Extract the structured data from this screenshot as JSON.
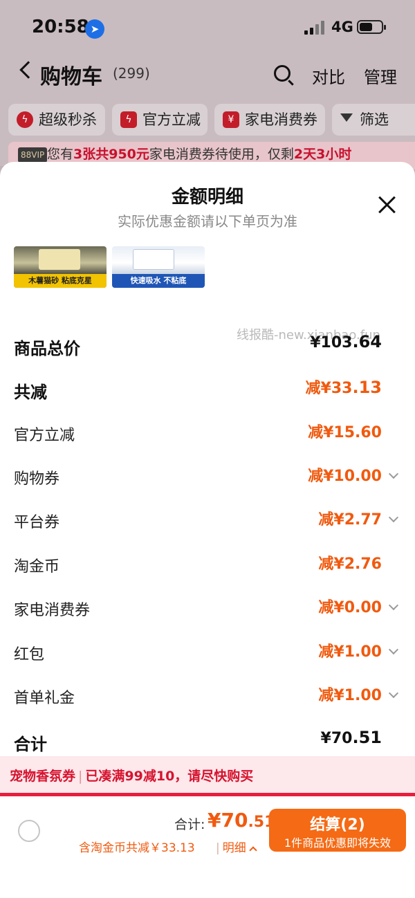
{
  "status_bar": {
    "time": "20:58",
    "network": "4G"
  },
  "cart_header": {
    "title": "购物车",
    "count": "(299)",
    "compare": "对比",
    "manage": "管理"
  },
  "filters": [
    {
      "label": "超级秒杀"
    },
    {
      "label": "官方立减"
    },
    {
      "label": "家电消费券"
    },
    {
      "label": "筛选"
    }
  ],
  "vip_notice": {
    "badge": "88VIP",
    "text_1": "您有",
    "highlight_1": "3张共950元",
    "text_2": "家电消费券待使用，仅剩",
    "highlight_2": "2天3小时"
  },
  "sheet": {
    "title": "金额明细",
    "subtitle": "实际优惠金额请以下单页为准",
    "thumbnails": [
      {
        "caption": "木薯猫砂 粘底克星"
      },
      {
        "caption": "快速吸水 不粘底"
      }
    ],
    "watermark": "线报酷-new.xianbao.fun",
    "goods_total": {
      "label": "商品总价",
      "currency": "¥",
      "int": "103",
      "dec": ".64"
    },
    "total_reduce": {
      "label": "共减",
      "prefix": "减¥",
      "int": "33",
      "dec": ".13"
    },
    "items": [
      {
        "label": "官方立减",
        "amount": "减¥15.60",
        "expandable": false
      },
      {
        "label": "购物券",
        "amount": "减¥10.00",
        "expandable": true
      },
      {
        "label": "平台券",
        "amount": "减¥2.77",
        "expandable": true
      },
      {
        "label": "淘金币",
        "amount": "减¥2.76",
        "expandable": false
      },
      {
        "label": "家电消费券",
        "amount": "减¥0.00",
        "expandable": true
      },
      {
        "label": "红包",
        "amount": "减¥1.00",
        "expandable": true
      },
      {
        "label": "首单礼金",
        "amount": "减¥1.00",
        "expandable": true
      }
    ],
    "grand_total": {
      "label": "合计",
      "currency": "¥",
      "int": "70",
      "dec": ".51"
    }
  },
  "promo": {
    "left": "宠物香氛券",
    "right": "已凑满99减10，请尽快购买"
  },
  "bottom_bar": {
    "sum_label": "合计:",
    "sum_currency": "¥",
    "sum_int": "70",
    "sum_dec": ".51",
    "note": "含淘金币共减￥33.13",
    "detail": "明细",
    "checkout_label": "结算(2)",
    "checkout_sub": "1件商品优惠即将失效"
  },
  "colors": {
    "accent": "#f05a0f",
    "brand_red": "#e81e3c",
    "checkout": "#f56a14"
  }
}
